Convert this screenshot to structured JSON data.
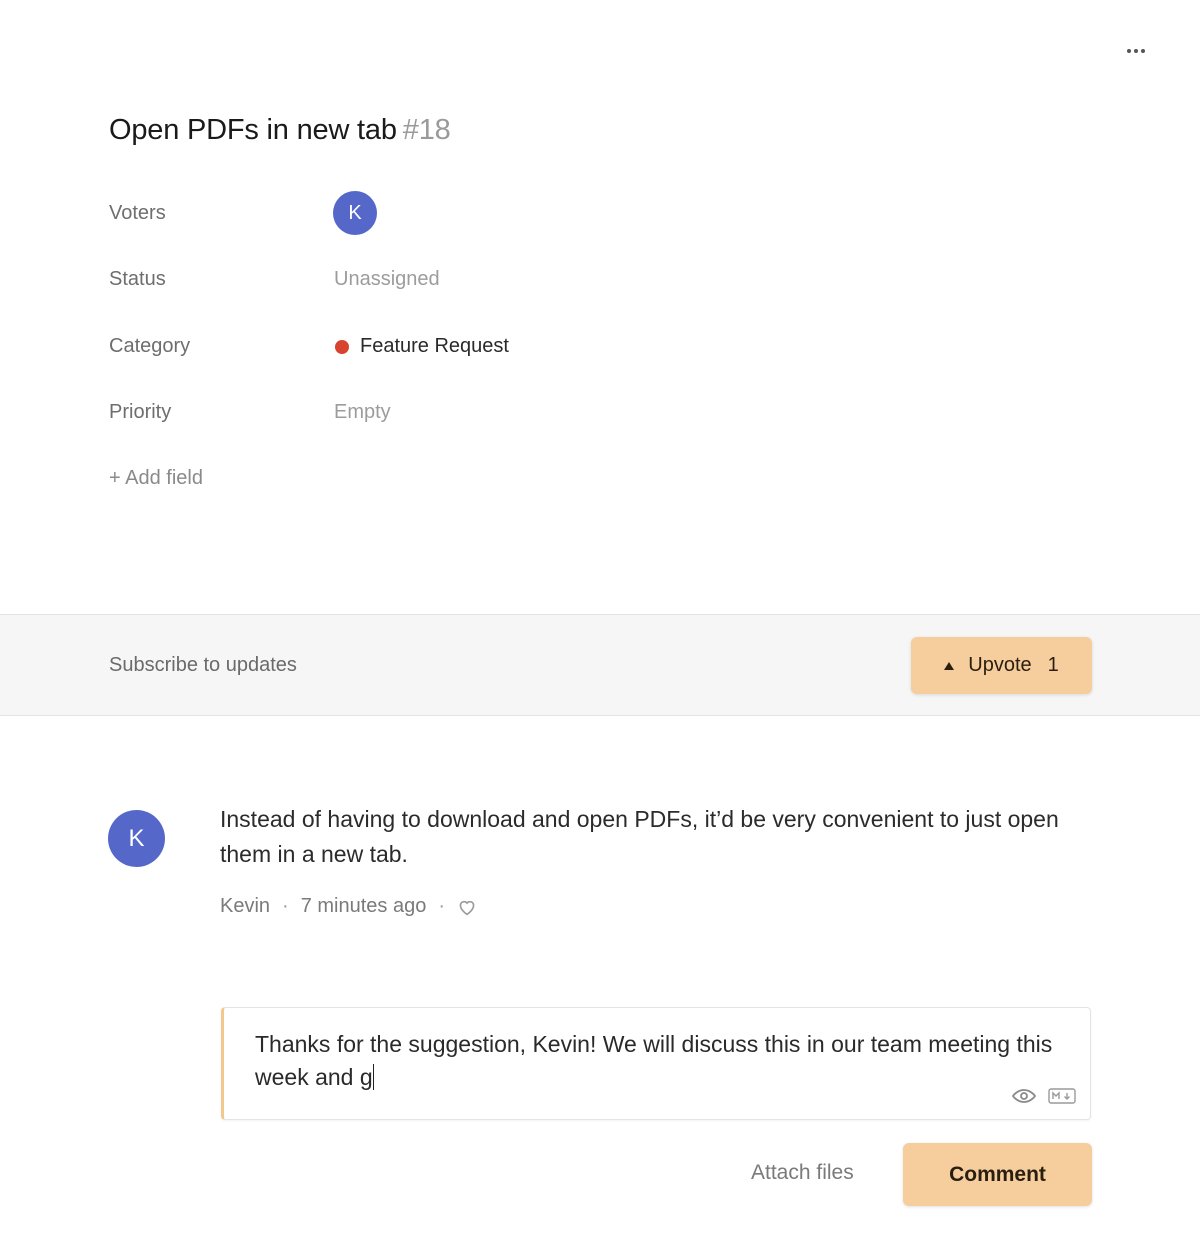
{
  "header": {
    "title": "Open PDFs in new tab",
    "number": "#18",
    "more_icon": "more-horizontal-icon"
  },
  "fields": {
    "voters": {
      "label": "Voters",
      "avatar_initial": "K",
      "avatar_color": "#5567c9"
    },
    "status": {
      "label": "Status",
      "value": "Unassigned"
    },
    "category": {
      "label": "Category",
      "value": "Feature Request",
      "dot_color": "#d8432f"
    },
    "priority": {
      "label": "Priority",
      "value": "Empty"
    },
    "add_field": "+ Add field"
  },
  "subscribe": {
    "label": "Subscribe to updates",
    "upvote_label": "Upvote",
    "upvote_count": "1",
    "accent": "#f6cd9c"
  },
  "post": {
    "avatar_initial": "K",
    "body": "Instead of having to download and open PDFs, it’d be very convenient to just open them in a new tab.",
    "author": "Kevin",
    "time": "7 minutes ago",
    "like_icon": "heart-icon"
  },
  "composer": {
    "text": "Thanks for the suggestion, Kevin! We will discuss this in our team meeting this week and g",
    "preview_icon": "eye-icon",
    "markdown_icon": "markdown-icon",
    "attach_label": "Attach files",
    "submit_label": "Comment"
  }
}
